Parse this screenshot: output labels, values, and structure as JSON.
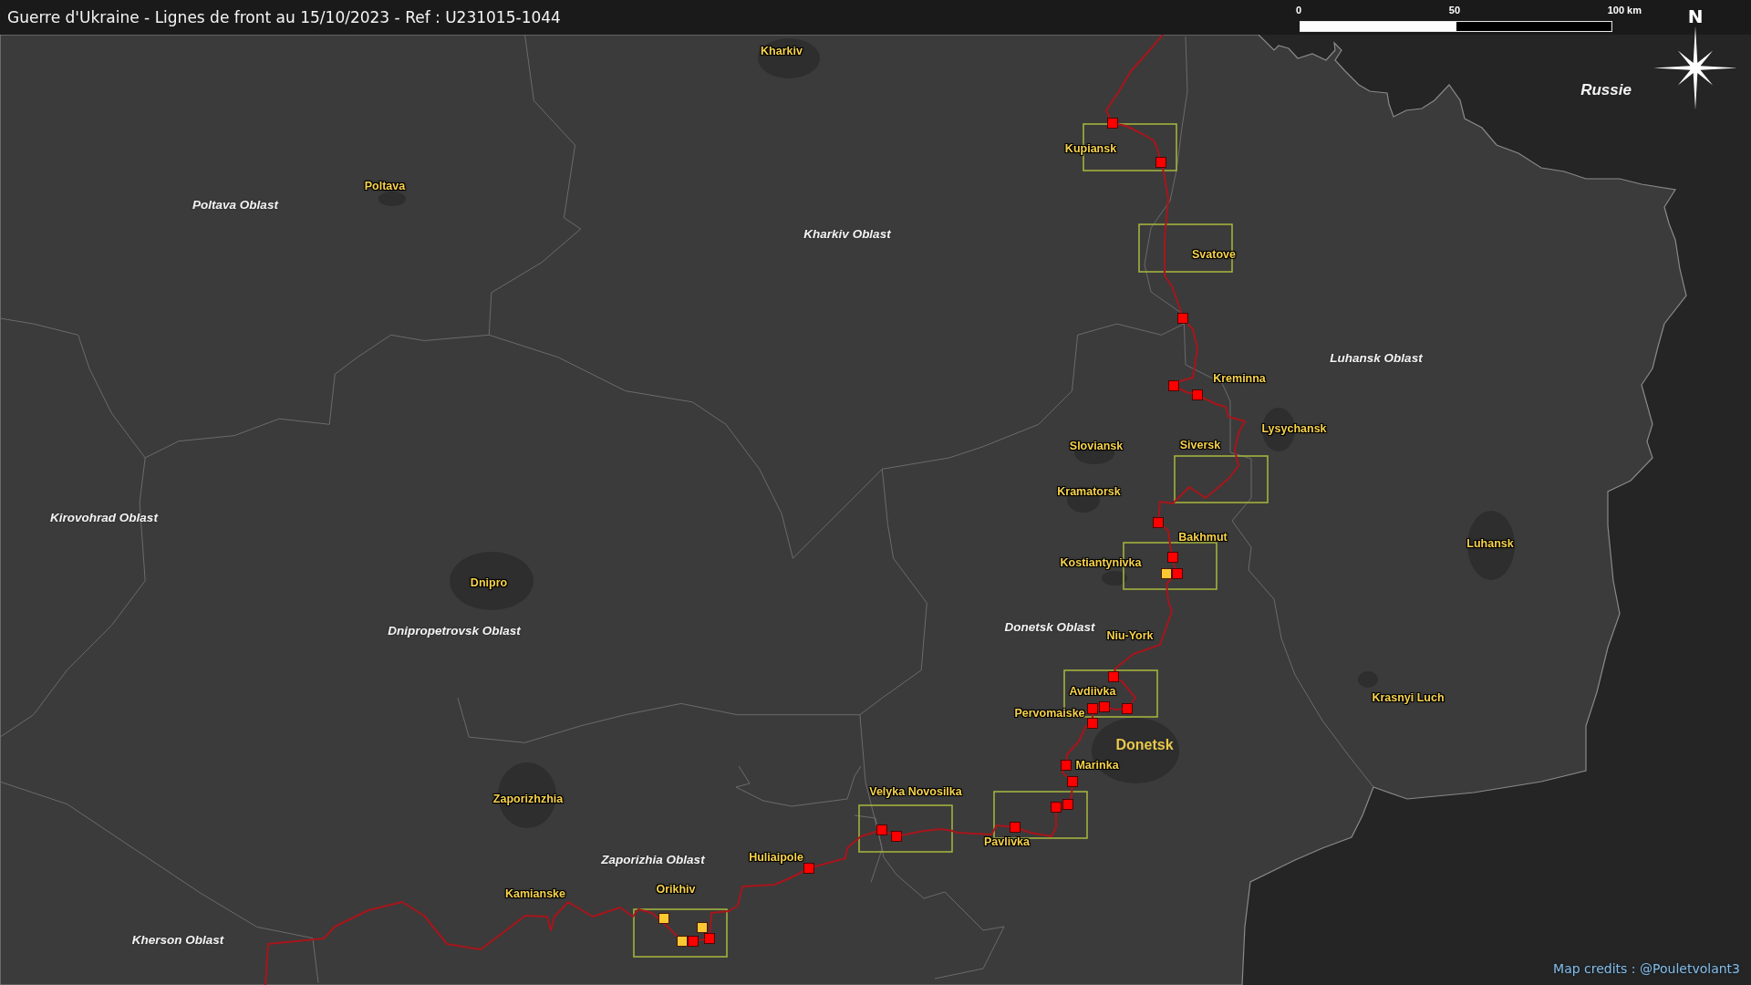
{
  "title": "Guerre d'Ukraine - Lignes de front au 15/10/2023 - Ref : U231015-1044",
  "scale_bar": {
    "labels": [
      "0",
      "50",
      "100 km"
    ]
  },
  "compass": {
    "label": "N"
  },
  "map": {
    "regions": [
      {
        "name": "Russie",
        "kind": "country"
      },
      {
        "name": "Poltava Oblast",
        "kind": "oblast"
      },
      {
        "name": "Kharkiv Oblast",
        "kind": "oblast"
      },
      {
        "name": "Luhansk Oblast",
        "kind": "oblast"
      },
      {
        "name": "Kirovohrad Oblast",
        "kind": "oblast"
      },
      {
        "name": "Donetsk Oblast",
        "kind": "oblast"
      },
      {
        "name": "Dnipropetrovsk Oblast",
        "kind": "oblast"
      },
      {
        "name": "Zaporizhia Oblast",
        "kind": "oblast"
      },
      {
        "name": "Kherson Oblast",
        "kind": "oblast"
      }
    ],
    "cities": [
      {
        "name": "Kharkiv",
        "kind": "town"
      },
      {
        "name": "Kupiansk",
        "kind": "town"
      },
      {
        "name": "Poltava",
        "kind": "town"
      },
      {
        "name": "Svatove",
        "kind": "town"
      },
      {
        "name": "Kreminna",
        "kind": "town"
      },
      {
        "name": "Lysychansk",
        "kind": "town"
      },
      {
        "name": "Siversk",
        "kind": "town"
      },
      {
        "name": "Sloviansk",
        "kind": "town"
      },
      {
        "name": "Kramatorsk",
        "kind": "town"
      },
      {
        "name": "Bakhmut",
        "kind": "town"
      },
      {
        "name": "Luhansk",
        "kind": "town"
      },
      {
        "name": "Kostiantynivka",
        "kind": "town"
      },
      {
        "name": "Dnipro",
        "kind": "town"
      },
      {
        "name": "Niu-York",
        "kind": "town"
      },
      {
        "name": "Avdiivka",
        "kind": "town"
      },
      {
        "name": "Krasnyi Luch",
        "kind": "town"
      },
      {
        "name": "Pervomaiske",
        "kind": "town"
      },
      {
        "name": "Donetsk",
        "kind": "major"
      },
      {
        "name": "Marinka",
        "kind": "town"
      },
      {
        "name": "Velyka Novosilka",
        "kind": "town"
      },
      {
        "name": "Zaporizhzhia",
        "kind": "town"
      },
      {
        "name": "Pavlivka",
        "kind": "town"
      },
      {
        "name": "Huliaipole",
        "kind": "town"
      },
      {
        "name": "Orikhiv",
        "kind": "town"
      },
      {
        "name": "Kamianske",
        "kind": "town"
      }
    ],
    "markers": [
      {
        "color": "#ff0000"
      },
      {
        "color": "#ff0000"
      },
      {
        "color": "#ff0000"
      },
      {
        "color": "#ff0000"
      },
      {
        "color": "#ff0000"
      },
      {
        "color": "#ff0000"
      },
      {
        "color": "#ff0000"
      },
      {
        "color": "#fcc832"
      },
      {
        "color": "#ff0000"
      },
      {
        "color": "#ff0000"
      },
      {
        "color": "#ff0000"
      },
      {
        "color": "#ff0000"
      },
      {
        "color": "#ff0000"
      },
      {
        "color": "#ff0000"
      },
      {
        "color": "#ff0000"
      },
      {
        "color": "#ff0000"
      },
      {
        "color": "#ff0000"
      },
      {
        "color": "#ff0000"
      },
      {
        "color": "#ff0000"
      },
      {
        "color": "#ff0000"
      },
      {
        "color": "#ff0000"
      },
      {
        "color": "#ff0000"
      },
      {
        "color": "#fcc832"
      },
      {
        "color": "#fcc832"
      },
      {
        "color": "#ff0000"
      },
      {
        "color": "#ff0000"
      },
      {
        "color": "#fcc832"
      }
    ]
  },
  "credits": "Map credits : @Pouletvolant3"
}
